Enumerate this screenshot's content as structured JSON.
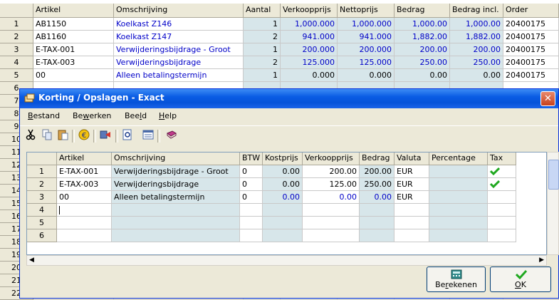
{
  "background_grid": {
    "columns": [
      "Artikel",
      "Omschrijving",
      "Aantal",
      "Verkoopprijs",
      "Nettoprijs",
      "Bedrag",
      "Bedrag incl.",
      "Order"
    ],
    "row_numbers": [
      "1",
      "2",
      "3",
      "4",
      "5",
      "6",
      "7",
      "8",
      "9",
      "10",
      "11",
      "12",
      "13",
      "14",
      "15",
      "16",
      "17",
      "18",
      "19",
      "20",
      "21",
      "22"
    ],
    "rows": [
      [
        "AB1150",
        "Koelkast Z146",
        "1",
        "1,000.000",
        "1,000.000",
        "1,000.00",
        "1,000.00",
        "20400175"
      ],
      [
        "AB1160",
        "Koelkast Z147",
        "2",
        "941.000",
        "941.000",
        "1,882.00",
        "1,882.00",
        "20400175"
      ],
      [
        "E-TAX-001",
        "Verwijderingsbijdrage - Groot",
        "1",
        "200.000",
        "200.000",
        "200.00",
        "200.00",
        "20400175"
      ],
      [
        "E-TAX-003",
        "Verwijderingsbijdrage",
        "2",
        "125.000",
        "125.000",
        "250.00",
        "250.00",
        "20400175"
      ],
      [
        "00",
        "Alleen betalingstermijn",
        "1",
        "0.000",
        "0.000",
        "0.00",
        "0.00",
        "20400175"
      ]
    ]
  },
  "dialog": {
    "title": "Korting / Opslagen - Exact",
    "close": "✕",
    "menu": [
      {
        "pre": "",
        "u": "B",
        "post": "estand"
      },
      {
        "pre": "Be",
        "u": "w",
        "post": "erken"
      },
      {
        "pre": "Bee",
        "u": "l",
        "post": "d"
      },
      {
        "pre": "",
        "u": "H",
        "post": "elp"
      }
    ],
    "toolbar_icons": [
      "cut-icon",
      "copy-icon",
      "paste-icon",
      "euro-icon",
      "export-icon",
      "preview-icon",
      "list-icon",
      "book-icon"
    ],
    "grid": {
      "columns": [
        "Artikel",
        "Omschrijving",
        "BTW",
        "Kostprijs",
        "Verkoopprijs",
        "Bedrag",
        "Valuta",
        "Percentage",
        "Tax"
      ],
      "row_numbers": [
        "1",
        "2",
        "3",
        "4",
        "5",
        "6"
      ],
      "rows": [
        {
          "artikel": "E-TAX-001",
          "omschrijving": "Verwijderingsbijdrage - Groot",
          "btw": "0",
          "kostprijs": "0.00",
          "verkoopprijs": "200.00",
          "bedrag": "200.00",
          "valuta": "EUR",
          "percentage": "",
          "tax": true
        },
        {
          "artikel": "E-TAX-003",
          "omschrijving": "Verwijderingsbijdrage",
          "btw": "0",
          "kostprijs": "0.00",
          "verkoopprijs": "125.00",
          "bedrag": "250.00",
          "valuta": "EUR",
          "percentage": "",
          "tax": true
        },
        {
          "artikel": "00",
          "omschrijving": "Alleen betalingstermijn",
          "btw": "0",
          "kostprijs": "0.00",
          "verkoopprijs": "0.00",
          "bedrag": "0.00",
          "valuta": "EUR",
          "percentage": "",
          "tax": false
        }
      ]
    },
    "buttons": {
      "calculate": {
        "pre": "Be",
        "u": "r",
        "post": "ekenen"
      },
      "ok": {
        "pre": "",
        "u": "O",
        "post": "K"
      }
    },
    "check_color": "#1fa81f",
    "value_blue": "#0000c8"
  }
}
